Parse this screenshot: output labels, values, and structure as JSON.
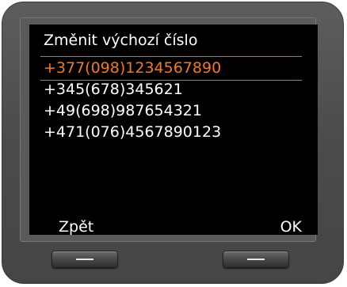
{
  "screen": {
    "title": "Změnit výchozí číslo",
    "accent_color": "#e06a1c",
    "items": [
      {
        "label": "+377(098)1234567890",
        "selected": true
      },
      {
        "label": "+345(678)345621",
        "selected": false
      },
      {
        "label": "+49(698)987654321",
        "selected": false
      },
      {
        "label": "+471(076)4567890123",
        "selected": false
      }
    ]
  },
  "softkeys": {
    "left_label": "Zpět",
    "right_label": "OK"
  },
  "hardware_keys": {
    "left_icon": "dash-icon",
    "right_icon": "dash-icon"
  }
}
